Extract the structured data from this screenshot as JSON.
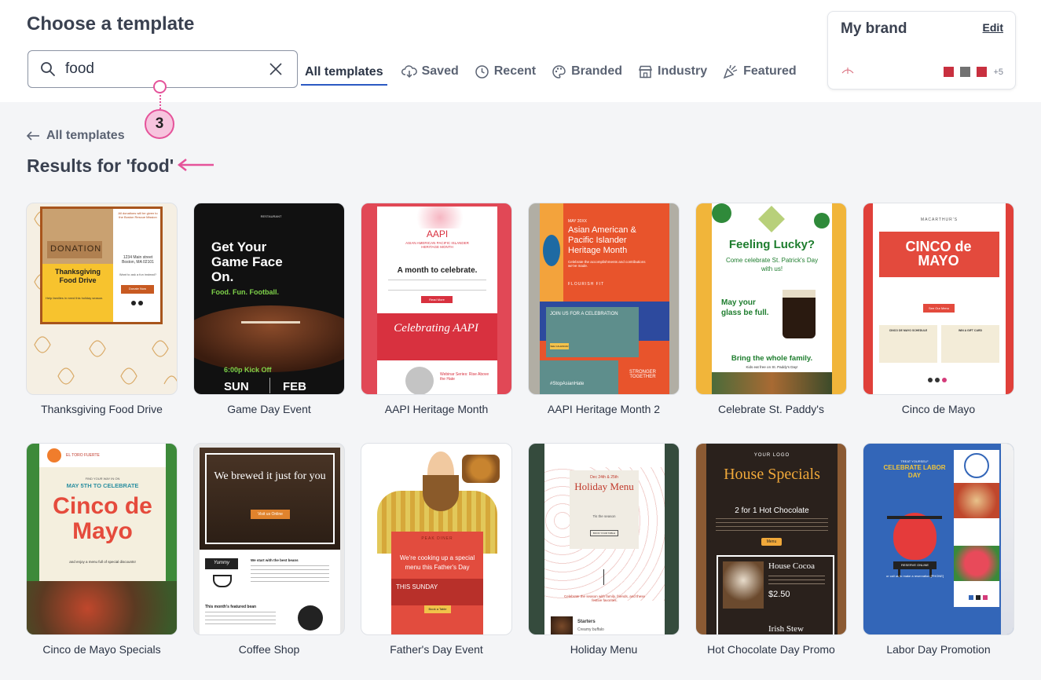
{
  "page": {
    "title": "Choose a template",
    "search_value": "food",
    "back_label": "All templates",
    "results_label": "Results for 'food'",
    "callout_number": "3"
  },
  "tabs": [
    {
      "label": "All templates",
      "icon": "none",
      "active": true
    },
    {
      "label": "Saved",
      "icon": "cloud-download-icon"
    },
    {
      "label": "Recent",
      "icon": "clock-icon"
    },
    {
      "label": "Branded",
      "icon": "palette-icon"
    },
    {
      "label": "Industry",
      "icon": "storefront-icon"
    },
    {
      "label": "Featured",
      "icon": "party-popper-icon"
    }
  ],
  "brand": {
    "title": "My brand",
    "edit_label": "Edit",
    "swatches": [
      "#c8303f",
      "#727272",
      "#c8303f"
    ],
    "more_count": "+5"
  },
  "colors": {
    "accent": "#2b59c3",
    "callout": "#e5539a"
  },
  "templates": [
    {
      "caption": "Thanksgiving Food Drive",
      "texts": [
        "DONATION",
        "Thanksgiving Food Drive",
        "All donations will be given to the Boston Rescue Mission",
        "1234 Main street Boston, MA 02101",
        "Want to ask a fun instead?",
        "Donate Now",
        "Help families in need this holiday season."
      ]
    },
    {
      "caption": "Game Day Event",
      "texts": [
        "RESTAURANT",
        "Get Your Game Face On.",
        "Food. Fun. Football.",
        "6:00p Kick Off",
        "SUN",
        "FEB"
      ]
    },
    {
      "caption": "AAPI Heritage Month",
      "texts": [
        "AAPI",
        "ASIAN AMERICAN PACIFIC ISLANDER HERITAGE MONTH",
        "A month to celebrate.",
        "Read More",
        "Celebrating AAPI",
        "Webinar Series: Rise Above the Hate"
      ]
    },
    {
      "caption": "AAPI Heritage Month 2",
      "texts": [
        "MAY 20XX",
        "Asian American & Pacific Islander Heritage Month",
        "Celebrate the accomplishments and contributions we've made.",
        "FLOURISH FIT",
        "JOIN US FOR A CELEBRATION",
        "SEE CALENDAR",
        "#StopAsianHate",
        "STRONGER TOGETHER"
      ]
    },
    {
      "caption": "Celebrate St. Paddy's",
      "texts": [
        "Feeling Lucky?",
        "Come celebrate St. Patrick's Day with us!",
        "May your glass be full.",
        "Bring the whole family.",
        "Kids eat free on St. Paddy's Day!"
      ]
    },
    {
      "caption": "Cinco de Mayo",
      "texts": [
        "MACARTHUR'S",
        "CINCO de MAYO",
        "See Our Menu",
        "CINCO DE MAYO SCHEDULE",
        "WIN A GIFT CARD"
      ]
    },
    {
      "caption": "Cinco de Mayo Specials",
      "texts": [
        "EL TORO FUERTE",
        "FIND YOUR WAY IN ON",
        "MAY 5TH TO CELEBRATE",
        "Cinco de Mayo",
        "and enjoy a menu full of special discounts!"
      ]
    },
    {
      "caption": "Coffee Shop",
      "texts": [
        "We brewed it just for you",
        "Visit us Online",
        "Yummy",
        "We start with the best beans",
        "This month's featured bean"
      ]
    },
    {
      "caption": "Father's Day Event",
      "texts": [
        "PEAK DINER",
        "We're cooking up a special menu this Father's Day",
        "THIS SUNDAY",
        "Book a Table"
      ]
    },
    {
      "caption": "Holiday Menu",
      "texts": [
        "Dec 24th & 25th",
        "Holiday Menu",
        "Tis the season",
        "BOOK YOUR TABLE",
        "Celebrate the season with family, friends, and these festive favorites.",
        "Starters",
        "Creamy buffalo"
      ]
    },
    {
      "caption": "Hot Chocolate Day Promo",
      "texts": [
        "YOUR LOGO",
        "House Specials",
        "2 for 1 Hot Chocolate",
        "Menu",
        "House Cocoa",
        "$2.50",
        "Irish Stew"
      ]
    },
    {
      "caption": "Labor Day Promotion",
      "texts": [
        "TREAT YOURSELF",
        "CELEBRATE LABOR DAY",
        "RESERVE ONLINE",
        "or call us to make a reservation [PHONE]"
      ]
    }
  ]
}
